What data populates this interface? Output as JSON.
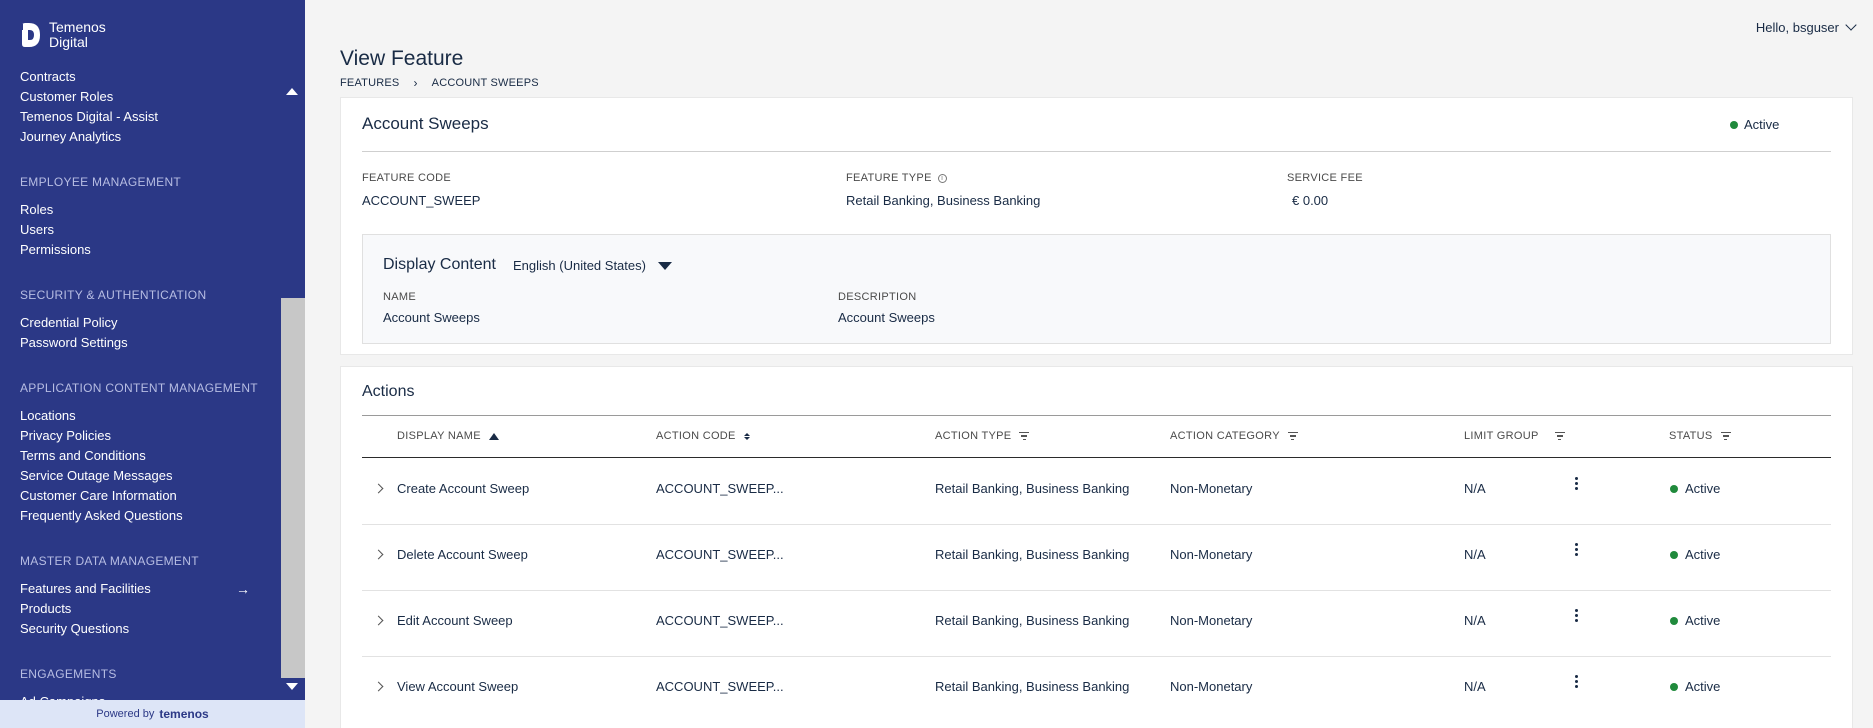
{
  "brand": {
    "line1": "Temenos",
    "line2": "Digital"
  },
  "sidebar": {
    "items_top": [
      "Contracts",
      "Customer Roles",
      "Temenos Digital - Assist",
      "Journey Analytics"
    ],
    "groups": [
      {
        "title": "EMPLOYEE MANAGEMENT",
        "items": [
          "Roles",
          "Users",
          "Permissions"
        ]
      },
      {
        "title": "SECURITY & AUTHENTICATION",
        "items": [
          "Credential Policy",
          "Password Settings"
        ]
      },
      {
        "title": "APPLICATION CONTENT MANAGEMENT",
        "items": [
          "Locations",
          "Privacy Policies",
          "Terms and Conditions",
          "Service Outage Messages",
          "Customer Care Information",
          "Frequently Asked Questions"
        ]
      },
      {
        "title": "MASTER DATA MANAGEMENT",
        "items": [
          "Features and Facilities",
          "Products",
          "Security Questions"
        ]
      },
      {
        "title": "ENGAGEMENTS",
        "items": [
          "Ad Campaigns"
        ]
      }
    ],
    "active_item": "Features and Facilities",
    "active_arrow": "→",
    "powered_by": "Powered by",
    "powered_brand": "temenos"
  },
  "header": {
    "greeting": "Hello, bsguser"
  },
  "page": {
    "title": "View Feature",
    "breadcrumb": {
      "parent": "FEATURES",
      "separator": "›",
      "current": "ACCOUNT SWEEPS"
    }
  },
  "feature": {
    "name": "Account Sweeps",
    "status": "Active",
    "status_color": "#208a3c",
    "feature_code_label": "FEATURE CODE",
    "feature_code": "ACCOUNT_SWEEP",
    "feature_type_label": "FEATURE TYPE",
    "feature_type": "Retail Banking, Business Banking",
    "service_fee_label": "SERVICE FEE",
    "service_fee": "€ 0.00"
  },
  "display_content": {
    "title": "Display Content",
    "language": "English (United States)",
    "name_label": "NAME",
    "name": "Account Sweeps",
    "description_label": "DESCRIPTION",
    "description": "Account Sweeps"
  },
  "actions": {
    "title": "Actions",
    "columns": [
      "DISPLAY NAME",
      "ACTION CODE",
      "ACTION TYPE",
      "ACTION CATEGORY",
      "LIMIT GROUP",
      "STATUS"
    ],
    "rows": [
      {
        "display_name": "Create Account Sweep",
        "action_code": "ACCOUNT_SWEEP...",
        "action_type": "Retail Banking, Business Banking",
        "action_category": "Non-Monetary",
        "limit_group": "N/A",
        "status": "Active"
      },
      {
        "display_name": "Delete Account Sweep",
        "action_code": "ACCOUNT_SWEEP...",
        "action_type": "Retail Banking, Business Banking",
        "action_category": "Non-Monetary",
        "limit_group": "N/A",
        "status": "Active"
      },
      {
        "display_name": "Edit Account Sweep",
        "action_code": "ACCOUNT_SWEEP...",
        "action_type": "Retail Banking, Business Banking",
        "action_category": "Non-Monetary",
        "limit_group": "N/A",
        "status": "Active"
      },
      {
        "display_name": "View Account Sweep",
        "action_code": "ACCOUNT_SWEEP...",
        "action_type": "Retail Banking, Business Banking",
        "action_category": "Non-Monetary",
        "limit_group": "N/A",
        "status": "Active"
      }
    ]
  },
  "colors": {
    "sidebar_bg": "#2b3886",
    "accent_text": "#192b45",
    "active_green": "#208a3c"
  }
}
